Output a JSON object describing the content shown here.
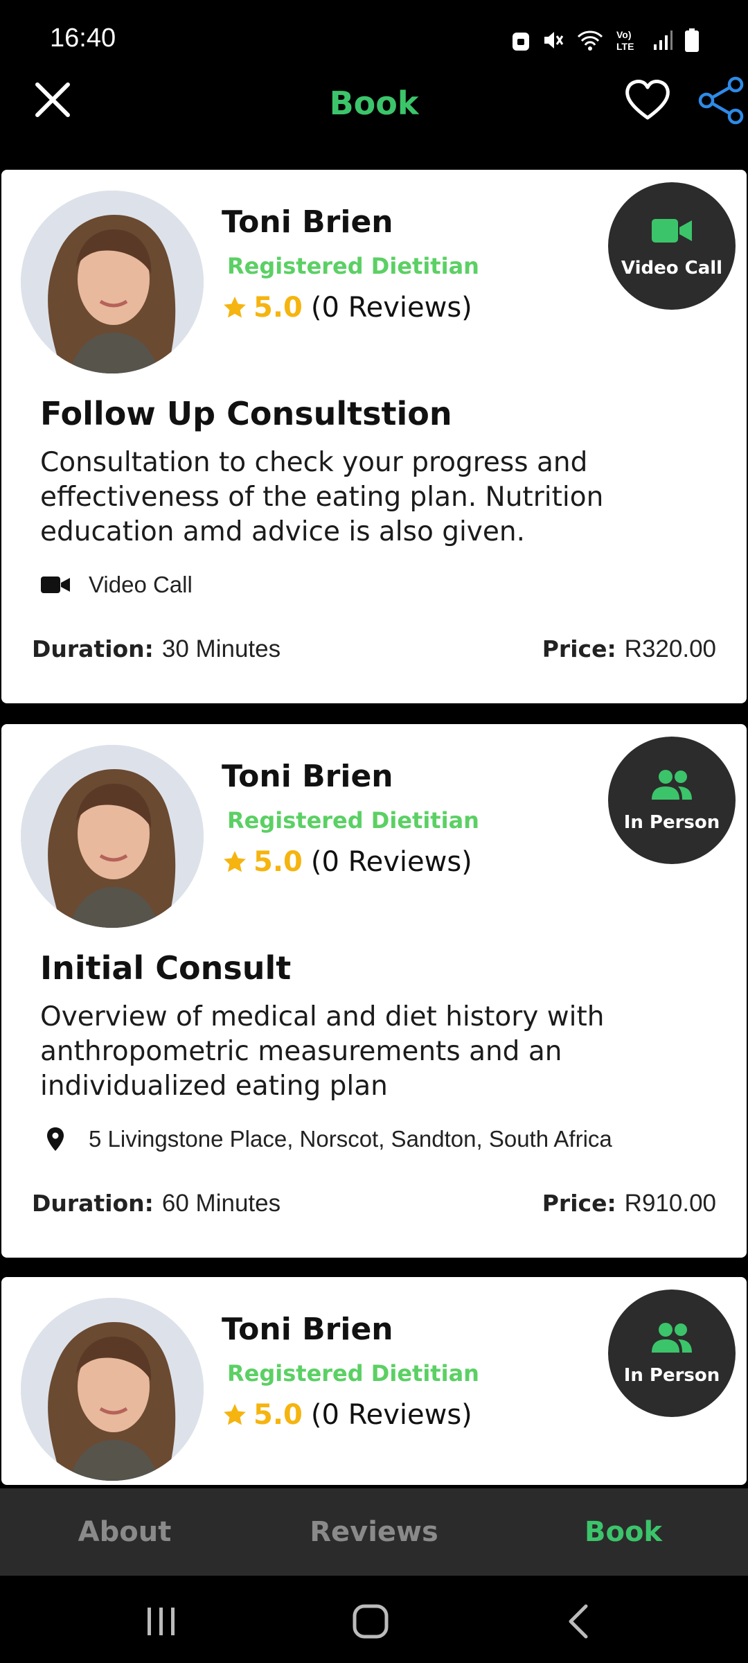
{
  "status_bar": {
    "time": "16:40"
  },
  "header": {
    "title": "Book"
  },
  "cards": [
    {
      "name": "Toni Brien",
      "title": "Registered Dietitian",
      "rating": "5.0",
      "reviews": "(0 Reviews)",
      "badge": "Video Call",
      "badge_icon": "video-camera-icon",
      "service_title": "Follow Up Consultstion",
      "description": "Consultation to check your progress and effectiveness of the eating plan. Nutrition education amd advice is also given.",
      "mode_text": "Video Call",
      "duration_label": "Duration:",
      "duration": "30 Minutes",
      "price_label": "Price:",
      "price": "R320.00"
    },
    {
      "name": "Toni Brien",
      "title": "Registered Dietitian",
      "rating": "5.0",
      "reviews": "(0 Reviews)",
      "badge": "In Person",
      "badge_icon": "people-icon",
      "service_title": "Initial Consult",
      "description": "Overview of medical and diet history with anthropometric measurements  and an individualized eating plan",
      "mode_text": "5 Livingstone Place, Norscot, Sandton, South Africa",
      "duration_label": "Duration:",
      "duration": "60 Minutes",
      "price_label": "Price:",
      "price": "R910.00"
    },
    {
      "name": "Toni Brien",
      "title": "Registered Dietitian",
      "rating": "5.0",
      "reviews": "(0 Reviews)",
      "badge": "In Person",
      "badge_icon": "people-icon"
    }
  ],
  "tabs": [
    {
      "label": "About",
      "active": false
    },
    {
      "label": "Reviews",
      "active": false
    },
    {
      "label": "Book",
      "active": true
    }
  ],
  "colors": {
    "accent_green": "#3cc46b",
    "title_green": "#5bd064",
    "star_yellow": "#f5b40f",
    "share_blue": "#2e8ae6"
  }
}
